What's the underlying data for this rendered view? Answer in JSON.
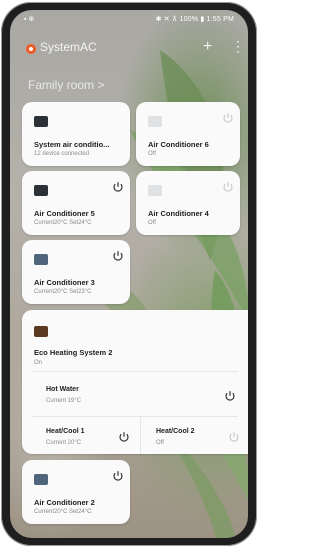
{
  "status_bar": {
    "left": "▪ ⊕",
    "right": "✱ ✕ ⊼ 100% ▮ 1:55 PM"
  },
  "app": {
    "title": "SystemAC",
    "add_label": "+",
    "more_label": "⋮",
    "room": "Family room >"
  },
  "devices": [
    {
      "name": "System air conditio...",
      "status": "12 device connected",
      "icon": "ac-system-icon",
      "power": false
    },
    {
      "name": "Air Conditioner 6",
      "status": "Off",
      "icon": "air-conditioner-icon",
      "power": true
    },
    {
      "name": "Air Conditioner 5",
      "status": "Current20°C  Set24°C",
      "icon": "air-conditioner-icon",
      "power": true
    },
    {
      "name": "Air Conditioner 4",
      "status": "Off",
      "icon": "air-conditioner-icon",
      "power": true
    },
    {
      "name": "Air Conditioner 3",
      "status": "Current20°C  Set23°C",
      "icon": "air-conditioner-icon",
      "power": true
    }
  ],
  "eco": {
    "name": "Eco Heating System 2",
    "status": "On",
    "hot_water": {
      "name": "Hot Water",
      "status": "Current 19°C"
    },
    "heat_cool_1": {
      "name": "Heat/Cool 1",
      "status": "Current 20°C"
    },
    "heat_cool_2": {
      "name": "Heat/Cool 2",
      "status": "Off"
    }
  },
  "bottom_device": {
    "name": "Air Conditioner 2",
    "status": "Current20°C  Set24°C"
  }
}
